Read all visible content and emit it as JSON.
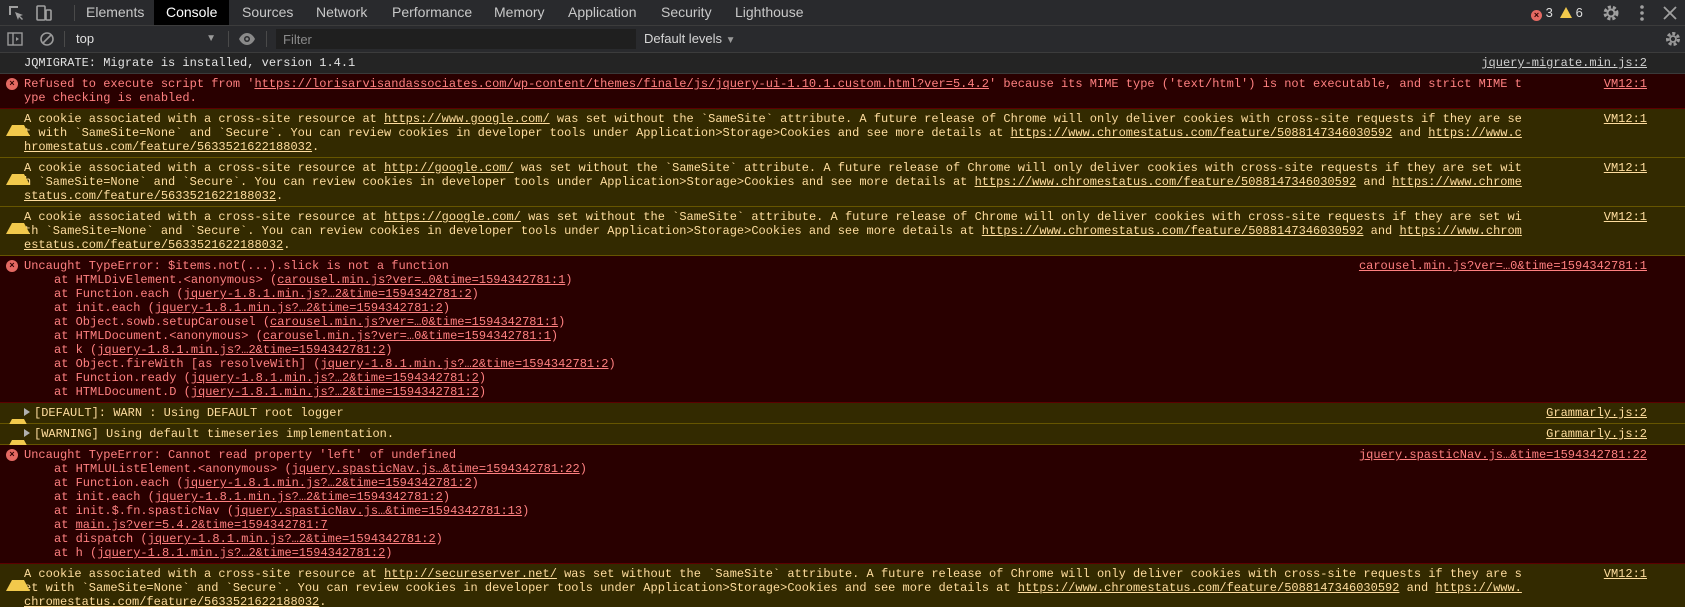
{
  "tabs": [
    {
      "label": "Elements",
      "selected": false
    },
    {
      "label": "Console",
      "selected": true
    },
    {
      "label": "Sources",
      "selected": false
    },
    {
      "label": "Network",
      "selected": false
    },
    {
      "label": "Performance",
      "selected": false
    },
    {
      "label": "Memory",
      "selected": false
    },
    {
      "label": "Application",
      "selected": false
    },
    {
      "label": "Security",
      "selected": false
    },
    {
      "label": "Lighthouse",
      "selected": false
    }
  ],
  "counters": {
    "errors": "3",
    "warnings": "6"
  },
  "toolbar": {
    "context": "top",
    "filter_placeholder": "Filter",
    "levels": "Default levels"
  },
  "icons": {
    "inspect": "inspect-element-icon",
    "device": "device-toolbar-icon",
    "settings": "gear-icon",
    "more": "kebab-menu-icon",
    "close": "close-icon",
    "sidebar": "sidebar-toggle-icon",
    "clear": "clear-console-icon",
    "eye": "live-expression-eye-icon"
  },
  "colors": {
    "error_bg": "#290000",
    "error_text": "#ff8080",
    "warning_bg": "#332a00",
    "warning_text": "#ffdd9e",
    "log_bg": "#242424"
  },
  "messages": [
    {
      "level": "log",
      "text": "JQMIGRATE: Migrate is installed, version 1.4.1",
      "source": "jquery-migrate.min.js:2"
    },
    {
      "level": "error",
      "parts": [
        {
          "t": "Refused to execute script from '"
        },
        {
          "t": "https://lorisarvisandassociates.com/wp-content/themes/finale/js/jquery-ui-1.10.1.custom.html?ver=5.4.2",
          "link": true
        },
        {
          "t": "' because its MIME type ('text/html') is not executable, and strict MIME type checking is enabled."
        }
      ],
      "source": "VM12:1"
    },
    {
      "level": "warning",
      "parts": [
        {
          "t": "A cookie associated with a cross-site resource at "
        },
        {
          "t": "https://www.google.com/",
          "link": true
        },
        {
          "t": " was set without the `SameSite` attribute. A future release of Chrome will only deliver cookies with cross-site requests if they are set with `SameSite=None` and `Secure`. You can review cookies in developer tools under Application>Storage>Cookies and see more details at "
        },
        {
          "t": "https://www.chromestatus.com/feature/5088147346030592",
          "link": true
        },
        {
          "t": " and "
        },
        {
          "t": "https://www.chromestatus.com/feature/5633521622188032",
          "link": true
        },
        {
          "t": "."
        }
      ],
      "source": "VM12:1"
    },
    {
      "level": "warning",
      "parts": [
        {
          "t": "A cookie associated with a cross-site resource at "
        },
        {
          "t": "http://google.com/",
          "link": true
        },
        {
          "t": " was set without the `SameSite` attribute. A future release of Chrome will only deliver cookies with cross-site requests if they are set with `SameSite=None` and `Secure`. You can review cookies in developer tools under Application>Storage>Cookies and see more details at "
        },
        {
          "t": "https://www.chromestatus.com/feature/5088147346030592",
          "link": true
        },
        {
          "t": " and "
        },
        {
          "t": "https://www.chromestatus.com/feature/5633521622188032",
          "link": true
        },
        {
          "t": "."
        }
      ],
      "source": "VM12:1"
    },
    {
      "level": "warning",
      "parts": [
        {
          "t": "A cookie associated with a cross-site resource at "
        },
        {
          "t": "https://google.com/",
          "link": true
        },
        {
          "t": " was set without the `SameSite` attribute. A future release of Chrome will only deliver cookies with cross-site requests if they are set with `SameSite=None` and `Secure`. You can review cookies in developer tools under Application>Storage>Cookies and see more details at "
        },
        {
          "t": "https://www.chromestatus.com/feature/5088147346030592",
          "link": true
        },
        {
          "t": " and "
        },
        {
          "t": "https://www.chromestatus.com/feature/5633521622188032",
          "link": true
        },
        {
          "t": "."
        }
      ],
      "source": "VM12:1"
    },
    {
      "level": "error",
      "parts": [
        {
          "t": "Uncaught TypeError: $items.not(...).slick is not a function"
        }
      ],
      "source": "carousel.min.js?ver=…0&time=1594342781:1",
      "stack": [
        {
          "pre": "at HTMLDivElement.<anonymous> (",
          "link": "carousel.min.js?ver=…0&time=1594342781:1",
          "post": ")"
        },
        {
          "pre": "at Function.each (",
          "link": "jquery-1.8.1.min.js?…2&time=1594342781:2",
          "post": ")"
        },
        {
          "pre": "at init.each (",
          "link": "jquery-1.8.1.min.js?…2&time=1594342781:2",
          "post": ")"
        },
        {
          "pre": "at Object.sowb.setupCarousel (",
          "link": "carousel.min.js?ver=…0&time=1594342781:1",
          "post": ")"
        },
        {
          "pre": "at HTMLDocument.<anonymous> (",
          "link": "carousel.min.js?ver=…0&time=1594342781:1",
          "post": ")"
        },
        {
          "pre": "at k (",
          "link": "jquery-1.8.1.min.js?…2&time=1594342781:2",
          "post": ")"
        },
        {
          "pre": "at Object.fireWith [as resolveWith] (",
          "link": "jquery-1.8.1.min.js?…2&time=1594342781:2",
          "post": ")"
        },
        {
          "pre": "at Function.ready (",
          "link": "jquery-1.8.1.min.js?…2&time=1594342781:2",
          "post": ")"
        },
        {
          "pre": "at HTMLDocument.D (",
          "link": "jquery-1.8.1.min.js?…2&time=1594342781:2",
          "post": ")"
        }
      ]
    },
    {
      "level": "warning",
      "expandable": true,
      "parts": [
        {
          "t": "[DEFAULT]: WARN : Using DEFAULT root logger"
        }
      ],
      "source": "Grammarly.js:2"
    },
    {
      "level": "warning",
      "expandable": true,
      "parts": [
        {
          "t": "[WARNING] Using default timeseries implementation."
        }
      ],
      "source": "Grammarly.js:2"
    },
    {
      "level": "error",
      "parts": [
        {
          "t": "Uncaught TypeError: Cannot read property 'left' of undefined"
        }
      ],
      "source": "jquery.spasticNav.js…&time=1594342781:22",
      "stack": [
        {
          "pre": "at HTMLUListElement.<anonymous> (",
          "link": "jquery.spasticNav.js…&time=1594342781:22",
          "post": ")"
        },
        {
          "pre": "at Function.each (",
          "link": "jquery-1.8.1.min.js?…2&time=1594342781:2",
          "post": ")"
        },
        {
          "pre": "at init.each (",
          "link": "jquery-1.8.1.min.js?…2&time=1594342781:2",
          "post": ")"
        },
        {
          "pre": "at init.$.fn.spasticNav (",
          "link": "jquery.spasticNav.js…&time=1594342781:13",
          "post": ")"
        },
        {
          "pre": "at ",
          "link": "main.js?ver=5.4.2&time=1594342781:7",
          "post": ""
        },
        {
          "pre": "at dispatch (",
          "link": "jquery-1.8.1.min.js?…2&time=1594342781:2",
          "post": ")"
        },
        {
          "pre": "at h (",
          "link": "jquery-1.8.1.min.js?…2&time=1594342781:2",
          "post": ")"
        }
      ]
    },
    {
      "level": "warning",
      "parts": [
        {
          "t": "A cookie associated with a cross-site resource at "
        },
        {
          "t": "http://secureserver.net/",
          "link": true
        },
        {
          "t": " was set without the `SameSite` attribute. A future release of Chrome will only deliver cookies with cross-site requests if they are set with `SameSite=None` and `Secure`. You can review cookies in developer tools under Application>Storage>Cookies and see more details at "
        },
        {
          "t": "https://www.chromestatus.com/feature/5088147346030592",
          "link": true
        },
        {
          "t": " and "
        },
        {
          "t": "https://www.chromestatus.com/feature/5633521622188032",
          "link": true
        },
        {
          "t": "."
        }
      ],
      "source": "VM12:1"
    }
  ]
}
